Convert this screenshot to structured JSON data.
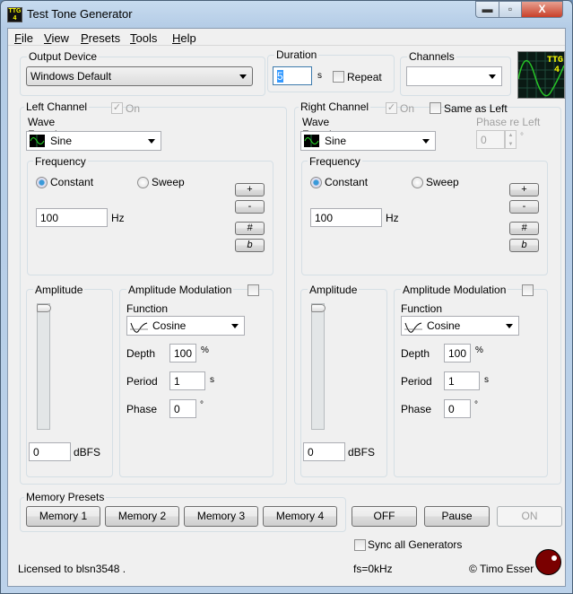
{
  "window": {
    "title": "Test Tone Generator",
    "logo_text": "TTG 4",
    "min": "▬",
    "max": "▫",
    "close": "X"
  },
  "menu": [
    "File",
    "View",
    "Presets",
    "Tools",
    "Help"
  ],
  "output_device": {
    "label": "Output Device",
    "value": "Windows Default"
  },
  "duration": {
    "label": "Duration",
    "value": "5",
    "unit": "s",
    "repeat_label": "Repeat",
    "repeat": false
  },
  "channels": {
    "label": "Channels",
    "value": ""
  },
  "left": {
    "title": "Left Channel",
    "on_label": "On",
    "on": true,
    "wave_label": "Wave Function",
    "wave": "Sine",
    "freq_label": "Frequency",
    "constant": "Constant",
    "sweep": "Sweep",
    "freq": "100",
    "freq_unit": "Hz",
    "plus": "+",
    "minus": "-",
    "sharp": "#",
    "flat": "b",
    "amp_label": "Amplitude",
    "amp": "0",
    "amp_unit": "dBFS",
    "amp_level": 1.0,
    "am_label": "Amplitude Modulation",
    "func_label": "Function",
    "func": "Cosine",
    "depth_label": "Depth",
    "depth": "100",
    "depth_unit": "%",
    "period_label": "Period",
    "period": "1",
    "period_unit": "s",
    "phase_label": "Phase",
    "phase": "0",
    "phase_unit": "°"
  },
  "right": {
    "title": "Right Channel",
    "on_label": "On",
    "on": true,
    "same_as_left": "Same as Left",
    "phase_re_left_label": "Phase re Left",
    "phase_re_left": "0",
    "phase_re_left_unit": "°",
    "wave_label": "Wave Function",
    "wave": "Sine",
    "freq_label": "Frequency",
    "constant": "Constant",
    "sweep": "Sweep",
    "freq": "100",
    "freq_unit": "Hz",
    "plus": "+",
    "minus": "-",
    "sharp": "#",
    "flat": "b",
    "amp_label": "Amplitude",
    "amp": "0",
    "amp_unit": "dBFS",
    "amp_level": 1.0,
    "am_label": "Amplitude Modulation",
    "func_label": "Function",
    "func": "Cosine",
    "depth_label": "Depth",
    "depth": "100",
    "depth_unit": "%",
    "period_label": "Period",
    "period": "1",
    "period_unit": "s",
    "phase_label": "Phase",
    "phase": "0",
    "phase_unit": "°"
  },
  "memory": {
    "label": "Memory Presets",
    "buttons": [
      "Memory 1",
      "Memory 2",
      "Memory 3",
      "Memory 4"
    ]
  },
  "controls": {
    "off": "OFF",
    "pause": "Pause",
    "on": "ON",
    "sync": "Sync all Generators"
  },
  "status": {
    "license": "Licensed to blsn3548 .",
    "fs": "fs=0kHz",
    "copyright": "© Timo Esser"
  },
  "colors": {
    "indicator": "#7a0000",
    "logo_bg": "#0a1a14",
    "logo_wave": "#27c427",
    "logo_text": "#ffff00"
  }
}
